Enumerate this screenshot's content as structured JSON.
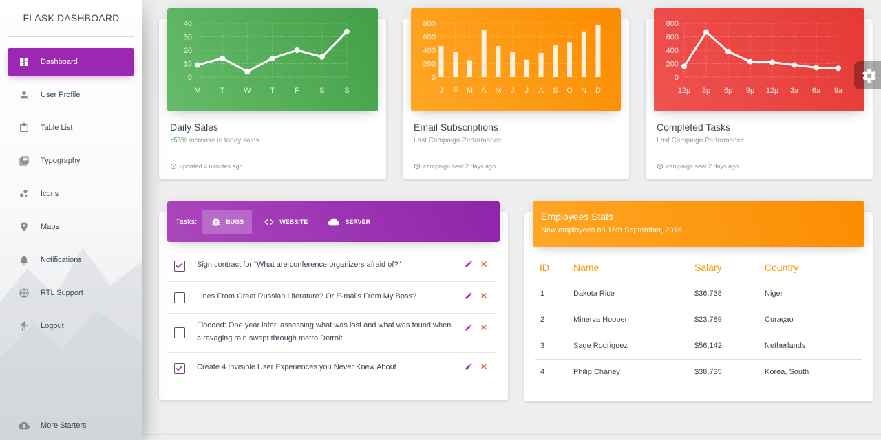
{
  "brand": "FLASK DASHBOARD",
  "nav": [
    {
      "label": "Dashboard",
      "icon": "dashboard-icon"
    },
    {
      "label": "User Profile",
      "icon": "person-icon"
    },
    {
      "label": "Table List",
      "icon": "clipboard-icon"
    },
    {
      "label": "Typography",
      "icon": "library-books-icon"
    },
    {
      "label": "Icons",
      "icon": "bubble-chart-icon"
    },
    {
      "label": "Maps",
      "icon": "location-pin-icon"
    },
    {
      "label": "Notifications",
      "icon": "bell-icon"
    },
    {
      "label": "RTL Support",
      "icon": "globe-icon"
    },
    {
      "label": "Logout",
      "icon": "running-person-icon"
    }
  ],
  "more_starters": "More Starters",
  "cards": [
    {
      "title": "Daily Sales",
      "category_pct": "55%",
      "category": " increase in today sales.",
      "footer": "updated 4 minutes ago",
      "color": "#4caf50"
    },
    {
      "title": "Email Subscriptions",
      "category": "Last Campaign Performance",
      "footer": "campaign sent 2 days ago",
      "color": "#ff9800"
    },
    {
      "title": "Completed Tasks",
      "category": "Last Campaign Performance",
      "footer": "campaign sent 2 days ago",
      "color": "#f44336"
    }
  ],
  "chart_data": [
    {
      "type": "line",
      "categories": [
        "M",
        "T",
        "W",
        "T",
        "F",
        "S",
        "S"
      ],
      "values": [
        9,
        14,
        4,
        14,
        20,
        15,
        34
      ],
      "y_ticks": [
        "0",
        "10",
        "20",
        "30",
        "40"
      ],
      "ylim": [
        0,
        40
      ],
      "grid": true
    },
    {
      "type": "bar",
      "categories": [
        "J",
        "F",
        "M",
        "A",
        "M",
        "J",
        "J",
        "A",
        "S",
        "O",
        "N",
        "D"
      ],
      "values": [
        460,
        370,
        250,
        700,
        460,
        380,
        260,
        360,
        480,
        520,
        680,
        780
      ],
      "y_ticks": [
        "0",
        "200",
        "400",
        "600",
        "800"
      ],
      "ylim": [
        0,
        800
      ],
      "grid": true
    },
    {
      "type": "line",
      "categories": [
        "12p",
        "3p",
        "6p",
        "9p",
        "12p",
        "3a",
        "6a",
        "9a"
      ],
      "values": [
        160,
        670,
        380,
        230,
        220,
        180,
        140,
        130
      ],
      "y_ticks": [
        "0",
        "200",
        "400",
        "600",
        "800"
      ],
      "ylim": [
        0,
        800
      ],
      "grid": true
    }
  ],
  "tasks": {
    "label": "Tasks:",
    "tabs": [
      {
        "label": "BUGS",
        "icon": "bug-icon"
      },
      {
        "label": "WEBSITE",
        "icon": "code-icon"
      },
      {
        "label": "SERVER",
        "icon": "cloud-icon"
      }
    ],
    "items": [
      {
        "text": "Sign contract for \"What are conference organizers afraid of?\"",
        "checked": true
      },
      {
        "text": "Lines From Great Russian Literature? Or E-mails From My Boss?",
        "checked": false
      },
      {
        "text": "Flooded: One year later, assessing what was lost and what was found when a ravaging rain swept through metro Detroit",
        "checked": false
      },
      {
        "text": "Create 4 Invisible User Experiences you Never Knew About",
        "checked": true
      }
    ]
  },
  "employees": {
    "title": "Employees Stats",
    "subtitle": "New employees on 15th September, 2016",
    "headers": [
      "ID",
      "Name",
      "Salary",
      "Country"
    ],
    "rows": [
      [
        "1",
        "Dakota Rice",
        "$36,738",
        "Niger"
      ],
      [
        "2",
        "Minerva Hooper",
        "$23,789",
        "Curaçao"
      ],
      [
        "3",
        "Sage Rodriguez",
        "$56,142",
        "Netherlands"
      ],
      [
        "4",
        "Philip Chaney",
        "$38,735",
        "Korea, South"
      ]
    ]
  },
  "colors": {
    "accent": "#9c27b0",
    "success": "#4caf50",
    "warning": "#ff9800",
    "danger": "#f44336"
  }
}
